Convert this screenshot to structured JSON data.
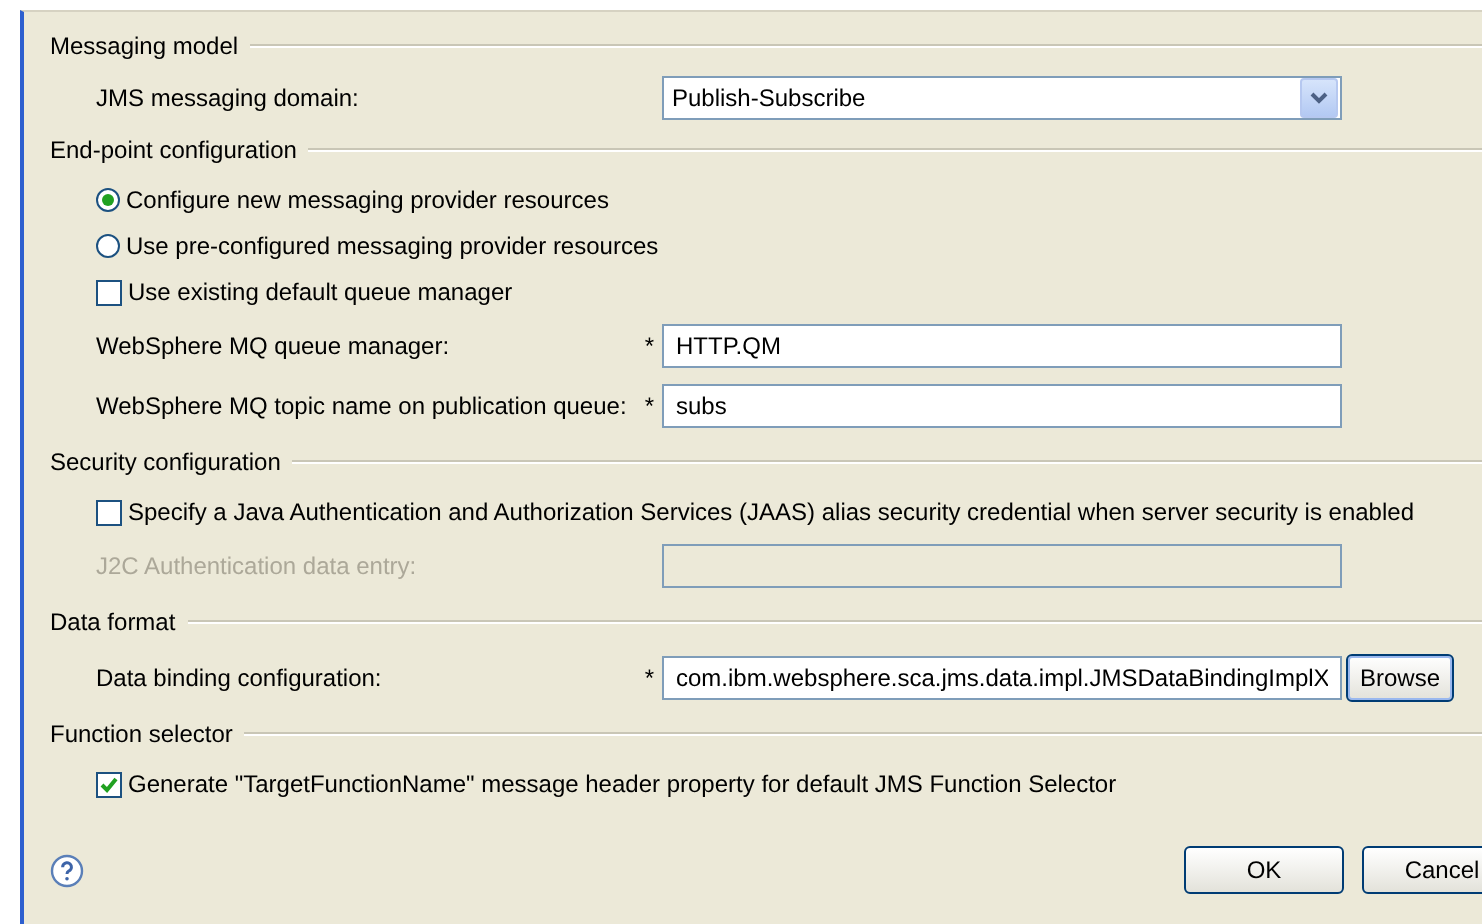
{
  "sections": [
    {
      "title": "Messaging model",
      "rows": [
        {
          "kind": "select",
          "label": "JMS messaging domain:",
          "value": "Publish-Subscribe"
        }
      ]
    },
    {
      "title": "End-point configuration",
      "rows": [
        {
          "kind": "radio",
          "label": "Configure new messaging provider resources",
          "selected": true
        },
        {
          "kind": "radio",
          "label": "Use pre-configured messaging provider resources",
          "selected": false
        },
        {
          "kind": "checkbox",
          "label": "Use existing default queue manager",
          "checked": false
        },
        {
          "kind": "text",
          "label": "WebSphere MQ queue manager:",
          "marker": "*",
          "value": "HTTP.QM",
          "disabled": false
        },
        {
          "kind": "text",
          "label": "WebSphere MQ topic name on publication queue:",
          "marker": "*",
          "value": "subs",
          "disabled": false
        }
      ]
    },
    {
      "title": "Security configuration",
      "rows": [
        {
          "kind": "checkbox",
          "label": "Specify a Java Authentication and Authorization Services (JAAS) alias security credential when server security is enabled",
          "checked": false
        },
        {
          "kind": "text",
          "label": "J2C Authentication data entry:",
          "disabled": true
        }
      ]
    },
    {
      "title": "Data format",
      "rows": [
        {
          "kind": "text",
          "label": "Data binding configuration:",
          "marker": "*",
          "value": "com.ibm.websphere.sca.jms.data.impl.JMSDataBindingImplX",
          "disabled": false,
          "button": "Browse"
        }
      ]
    },
    {
      "title": "Function selector",
      "rows": [
        {
          "kind": "checkbox",
          "label": "Generate \"TargetFunctionName\" message header property for default JMS Function Selector",
          "checked": true
        }
      ]
    }
  ],
  "buttons": [
    "OK",
    "Cancel"
  ]
}
